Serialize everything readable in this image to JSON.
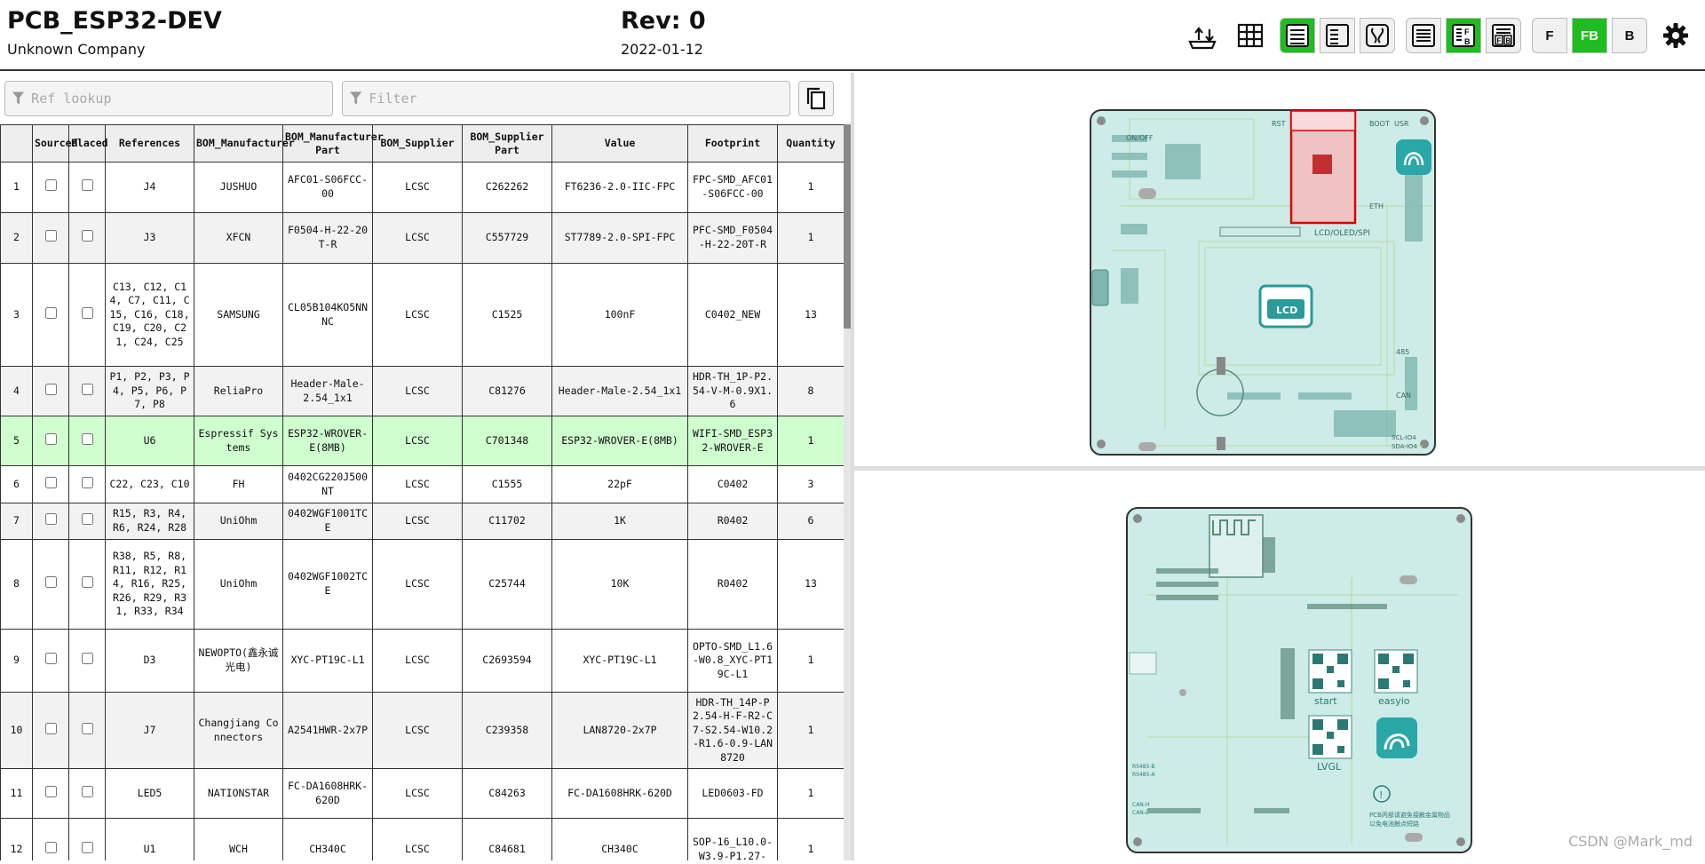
{
  "header": {
    "title": "PCB_ESP32-DEV",
    "company": "Unknown Company",
    "revision": "Rev: 0",
    "date": "2022-01-12"
  },
  "toolbar": {
    "icons": [
      "upload-download-icon",
      "grid-icon",
      "bom-only-icon",
      "bom-left-drawings-right-icon",
      "bom-top-drawings-bottom-icon",
      "list-icon",
      "front-back-stacked-icon",
      "front-back-side-icon",
      "gear-icon"
    ],
    "layer_buttons": {
      "front": "F",
      "front_back": "FB",
      "back": "B"
    },
    "accent_color": "#1fbd1f"
  },
  "search": {
    "ref_placeholder": "Ref lookup",
    "filter_placeholder": "Filter"
  },
  "table": {
    "headers": [
      "",
      "Sourced",
      "Placed",
      "References",
      "BOM_Manufacturer",
      "BOM_Manufacturer Part",
      "BOM_Supplier",
      "BOM_Supplier Part",
      "Value",
      "Footprint",
      "Quantity"
    ],
    "rows": [
      {
        "n": "1",
        "refs": "J4",
        "mfr": "JUSHUO",
        "mfr_part": "AFC01-S06FCC-00",
        "supplier": "LCSC",
        "supplier_part": "C262262",
        "value": "FT6236-2.0-IIC-FPC",
        "footprint": "FPC-SMD_AFC01-S06FCC-00",
        "qty": "1"
      },
      {
        "n": "2",
        "refs": "J3",
        "mfr": "XFCN",
        "mfr_part": "F0504-H-22-20T-R",
        "supplier": "LCSC",
        "supplier_part": "C557729",
        "value": "ST7789-2.0-SPI-FPC",
        "footprint": "PFC-SMD_F0504-H-22-20T-R",
        "qty": "1"
      },
      {
        "n": "3",
        "refs": "C13, C12, C14, C7, C11, C15, C16, C18, C19, C20, C21, C24, C25",
        "mfr": "SAMSUNG",
        "mfr_part": "CL05B104KO5NNNC",
        "supplier": "LCSC",
        "supplier_part": "C1525",
        "value": "100nF",
        "footprint": "C0402_NEW",
        "qty": "13"
      },
      {
        "n": "4",
        "refs": "P1, P2, P3, P4, P5, P6, P7, P8",
        "mfr": "ReliaPro",
        "mfr_part": "Header-Male-2.54_1x1",
        "supplier": "LCSC",
        "supplier_part": "C81276",
        "value": "Header-Male-2.54_1x1",
        "footprint": "HDR-TH_1P-P2.54-V-M-0.9X1.6",
        "qty": "8"
      },
      {
        "n": "5",
        "refs": "U6",
        "mfr": "Espressif Systems",
        "mfr_part": "ESP32-WROVER-E(8MB)",
        "supplier": "LCSC",
        "supplier_part": "C701348",
        "value": "ESP32-WROVER-E(8MB)",
        "footprint": "WIFI-SMD_ESP32-WROVER-E",
        "qty": "1"
      },
      {
        "n": "6",
        "refs": "C22, C23, C10",
        "mfr": "FH",
        "mfr_part": "0402CG220J500NT",
        "supplier": "LCSC",
        "supplier_part": "C1555",
        "value": "22pF",
        "footprint": "C0402",
        "qty": "3"
      },
      {
        "n": "7",
        "refs": "R15, R3, R4, R6, R24, R28",
        "mfr": "UniOhm",
        "mfr_part": "0402WGF1001TCE",
        "supplier": "LCSC",
        "supplier_part": "C11702",
        "value": "1K",
        "footprint": "R0402",
        "qty": "6"
      },
      {
        "n": "8",
        "refs": "R38, R5, R8, R11, R12, R14, R16, R25, R26, R29, R31, R33, R34",
        "mfr": "UniOhm",
        "mfr_part": "0402WGF1002TCE",
        "supplier": "LCSC",
        "supplier_part": "C25744",
        "value": "10K",
        "footprint": "R0402",
        "qty": "13"
      },
      {
        "n": "9",
        "refs": "D3",
        "mfr": "NEWOPTO(鑫永诚光电)",
        "mfr_part": "XYC-PT19C-L1",
        "supplier": "LCSC",
        "supplier_part": "C2693594",
        "value": "XYC-PT19C-L1",
        "footprint": "OPTO-SMD_L1.6-W0.8_XYC-PT19C-L1",
        "qty": "1"
      },
      {
        "n": "10",
        "refs": "J7",
        "mfr": "Changjiang Connectors",
        "mfr_part": "A2541HWR-2x7P",
        "supplier": "LCSC",
        "supplier_part": "C239358",
        "value": "LAN8720-2x7P",
        "footprint": "HDR-TH_14P-P2.54-H-F-R2-C7-S2.54-W10.2-R1.6-0.9-LAN8720",
        "qty": "1"
      },
      {
        "n": "11",
        "refs": "LED5",
        "mfr": "NATIONSTAR",
        "mfr_part": "FC-DA1608HRK-620D",
        "supplier": "LCSC",
        "supplier_part": "C84263",
        "value": "FC-DA1608HRK-620D",
        "footprint": "LED0603-FD",
        "qty": "1"
      },
      {
        "n": "12",
        "refs": "U1",
        "mfr": "WCH",
        "mfr_part": "CH340C",
        "supplier": "LCSC",
        "supplier_part": "C84681",
        "value": "CH340C",
        "footprint": "SOP-16_L10.0-W3.9-P1.27-",
        "qty": "1"
      }
    ]
  },
  "front_board": {
    "labels": [
      "ON/OFF",
      "RST",
      "BOOT",
      "USR",
      "ETH",
      "LCD/OLED/SPI",
      "LCD",
      "485",
      "CAN",
      "SCL-IO4",
      "SDA-IO4"
    ]
  },
  "back_board": {
    "labels": [
      "start",
      "easyio",
      "LVGL",
      "RS485-B",
      "RS485-A",
      "CAN-H",
      "CAN-L",
      "PCB丙部请避免接触金属物品",
      "以免电池触点短路"
    ]
  },
  "watermark": "CSDN @Mark_md"
}
